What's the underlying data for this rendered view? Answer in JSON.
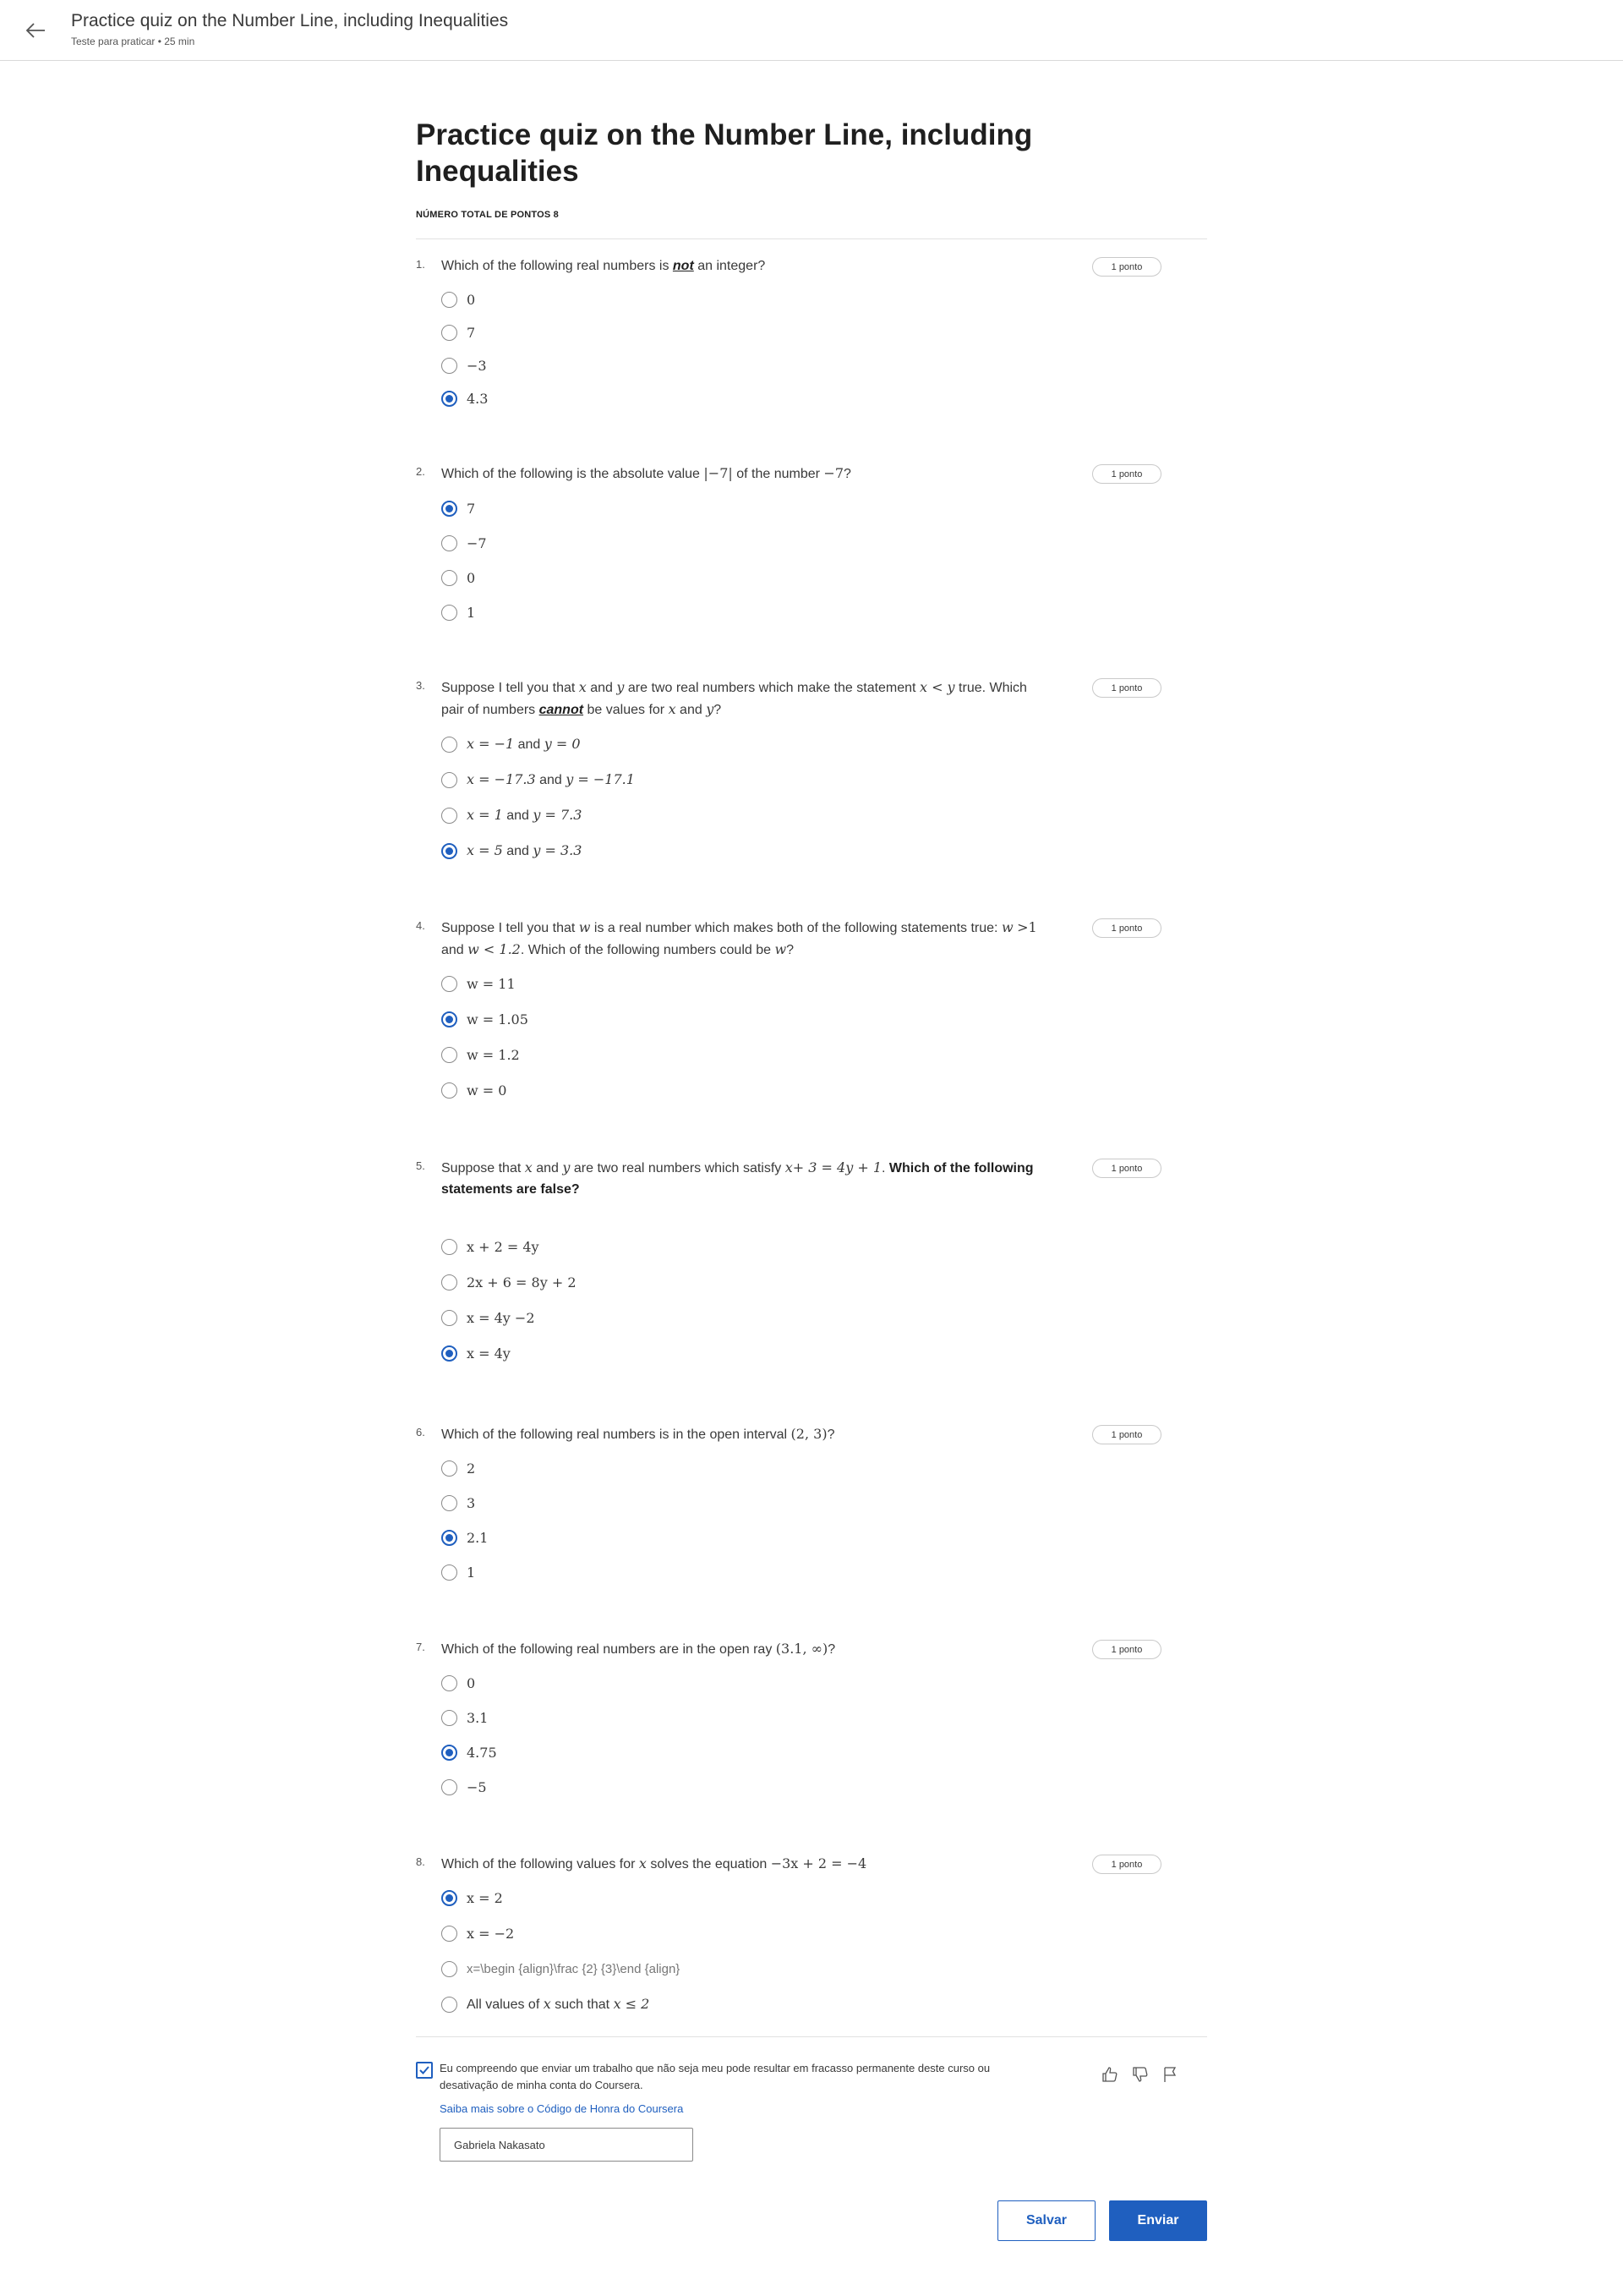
{
  "header": {
    "title": "Practice quiz on the Number Line, including Inequalities",
    "subtitle": "Teste para praticar • 25 min",
    "back_icon": "arrow-left-icon"
  },
  "quiz": {
    "title": "Practice quiz on the Number Line, including Inequalities",
    "total_points_label": "NÚMERO TOTAL DE PONTOS 8"
  },
  "points_label": "1 ponto",
  "questions": [
    {
      "number": "1.",
      "text_parts": [
        "Which of the following real numbers is ",
        "not",
        " an integer?"
      ],
      "options": [
        "0",
        "7",
        "−3",
        "4.3"
      ],
      "selected": 3
    },
    {
      "number": "2.",
      "text_parts": [
        "Which of the following is the absolute value ",
        "|−7|",
        " of the number ",
        "−7",
        "?"
      ],
      "options": [
        "7",
        "−7",
        "0",
        "1"
      ],
      "selected": 0
    },
    {
      "number": "3.",
      "text_parts": [
        "Suppose I tell you that ",
        "x",
        " and ",
        "y",
        " are two real numbers which make the statement ",
        "x < y",
        " true. Which pair of numbers ",
        "cannot",
        " be values for ",
        "x",
        " and ",
        "y",
        "?"
      ],
      "options": [
        [
          "x = −1",
          " and ",
          "y = 0"
        ],
        [
          "x = −17.3",
          " and ",
          "y = −17.1"
        ],
        [
          "x = 1",
          " and ",
          "y = 7.3"
        ],
        [
          "x = 5",
          " and ",
          "y = 3.3"
        ]
      ],
      "selected": 3
    },
    {
      "number": "4.",
      "text_parts": [
        "Suppose I tell you that ",
        "w",
        " is a real number which makes both of the following statements true: ",
        "w",
        " ",
        ">1",
        " and ",
        "w < 1.2",
        ". Which of the following numbers could be ",
        "w",
        "?"
      ],
      "options": [
        "w = 11",
        "w = 1.05",
        "w = 1.2",
        "w = 0"
      ],
      "selected": 1
    },
    {
      "number": "5.",
      "text_parts": [
        "Suppose that ",
        "x",
        " and ",
        "y",
        " are two real numbers which satisfy ",
        "x+ 3 = 4y + 1",
        ". ",
        "Which of the following statements are false?"
      ],
      "options": [
        "x + 2 = 4y",
        "2x + 6 = 8y + 2",
        "x = 4y −2",
        "x = 4y"
      ],
      "selected": 3
    },
    {
      "number": "6.",
      "text_parts": [
        "Which of the following real numbers is in the open interval ",
        "(2, 3)",
        "?"
      ],
      "options": [
        "2",
        "3",
        "2.1",
        "1"
      ],
      "selected": 2
    },
    {
      "number": "7.",
      "text_parts": [
        "Which of the following real numbers are in the open ray ",
        "(3.1, ∞)",
        "?"
      ],
      "options": [
        "0",
        "3.1",
        "4.75",
        "−5"
      ],
      "selected": 2
    },
    {
      "number": "8.",
      "text_parts": [
        "Which of the following values for ",
        "x",
        " solves the equation ",
        "−3x + 2 = −4"
      ],
      "options": [
        "x = 2",
        "x = −2",
        "x=\\begin {align}\\frac {2} {3}\\end {align}",
        [
          "All values of ",
          "x",
          " such that ",
          "x ≤ 2"
        ]
      ],
      "selected": 0
    }
  ],
  "honor_code": {
    "checked": true,
    "text": "Eu compreendo que enviar um trabalho que não seja meu pode resultar em fracasso permanente deste curso ou desativação de minha conta do Coursera.",
    "link": "Saiba mais sobre o Código de Honra do Coursera",
    "name_value": "Gabriela Nakasato"
  },
  "feedback_icons": [
    "thumbs-up-icon",
    "thumbs-down-icon",
    "flag-icon"
  ],
  "buttons": {
    "save": "Salvar",
    "submit": "Enviar"
  },
  "colors": {
    "accent": "#1f5fbf",
    "text": "#3a3a3a",
    "border": "#d9d9d9"
  }
}
